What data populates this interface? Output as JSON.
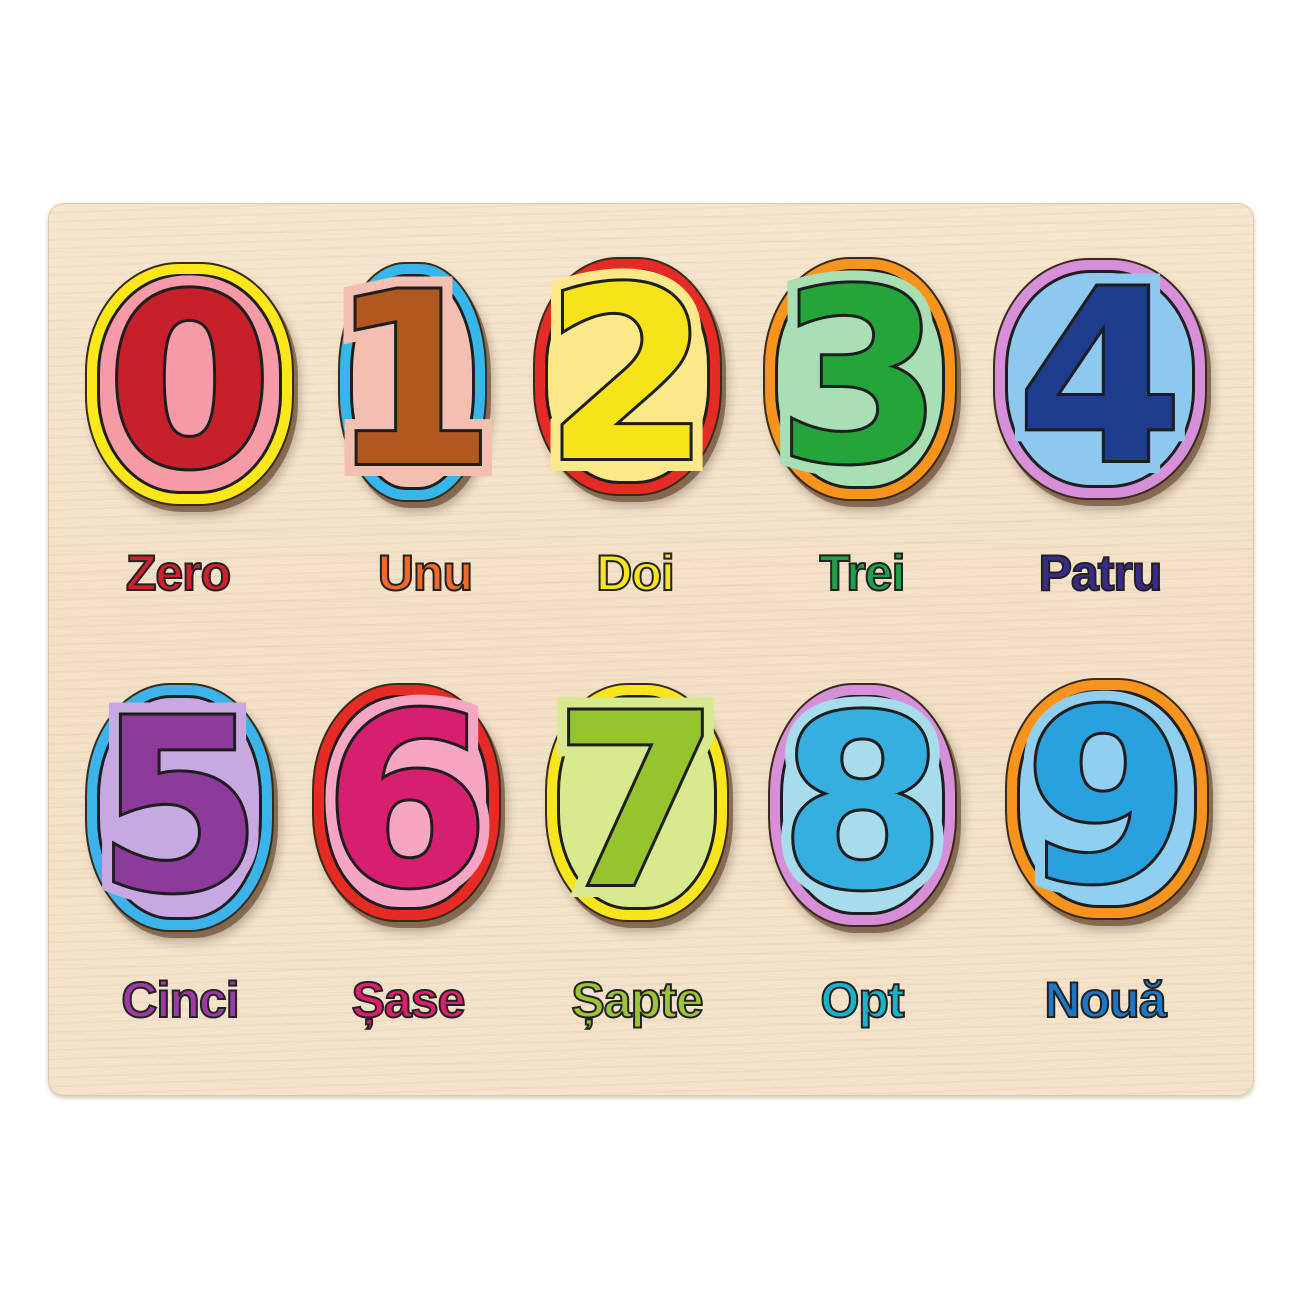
{
  "pieces": [
    {
      "digit": "0",
      "word": "Zero",
      "outer": "#fce81a",
      "ring": "#f59aa6",
      "fill": "#c8202a",
      "word_color": "#d0212b"
    },
    {
      "digit": "1",
      "word": "Unu",
      "outer": "#36b6ea",
      "ring": "#f3bfb0",
      "fill": "#b0581e",
      "word_color": "#f26a2a"
    },
    {
      "digit": "2",
      "word": "Doi",
      "outer": "#e52b24",
      "ring": "#fbe889",
      "fill": "#f7e31a",
      "word_color": "#f8e51e"
    },
    {
      "digit": "3",
      "word": "Trei",
      "outer": "#f7941d",
      "ring": "#a8dfb4",
      "fill": "#26a43c",
      "word_color": "#1fa04a"
    },
    {
      "digit": "4",
      "word": "Patru",
      "outer": "#d68fd8",
      "ring": "#8fc8ee",
      "fill": "#1e3d8f",
      "word_color": "#3a2a8c"
    },
    {
      "digit": "5",
      "word": "Cinci",
      "outer": "#3cb4ea",
      "ring": "#c8a8e2",
      "fill": "#8c3a9c",
      "word_color": "#9c3aa6"
    },
    {
      "digit": "6",
      "word": "Șase",
      "outer": "#e52b24",
      "ring": "#f6a6c4",
      "fill": "#d81e6e",
      "word_color": "#e01e6e"
    },
    {
      "digit": "7",
      "word": "Șapte",
      "outer": "#f9e51c",
      "ring": "#d8ea8e",
      "fill": "#96c42c",
      "word_color": "#9cc43a"
    },
    {
      "digit": "8",
      "word": "Opt",
      "outer": "#d68fd8",
      "ring": "#a6dcec",
      "fill": "#36aee0",
      "word_color": "#1ab4c8"
    },
    {
      "digit": "9",
      "word": "Nouă",
      "outer": "#f7941d",
      "ring": "#90cfef",
      "fill": "#2aa0de",
      "word_color": "#1c78c6"
    }
  ]
}
